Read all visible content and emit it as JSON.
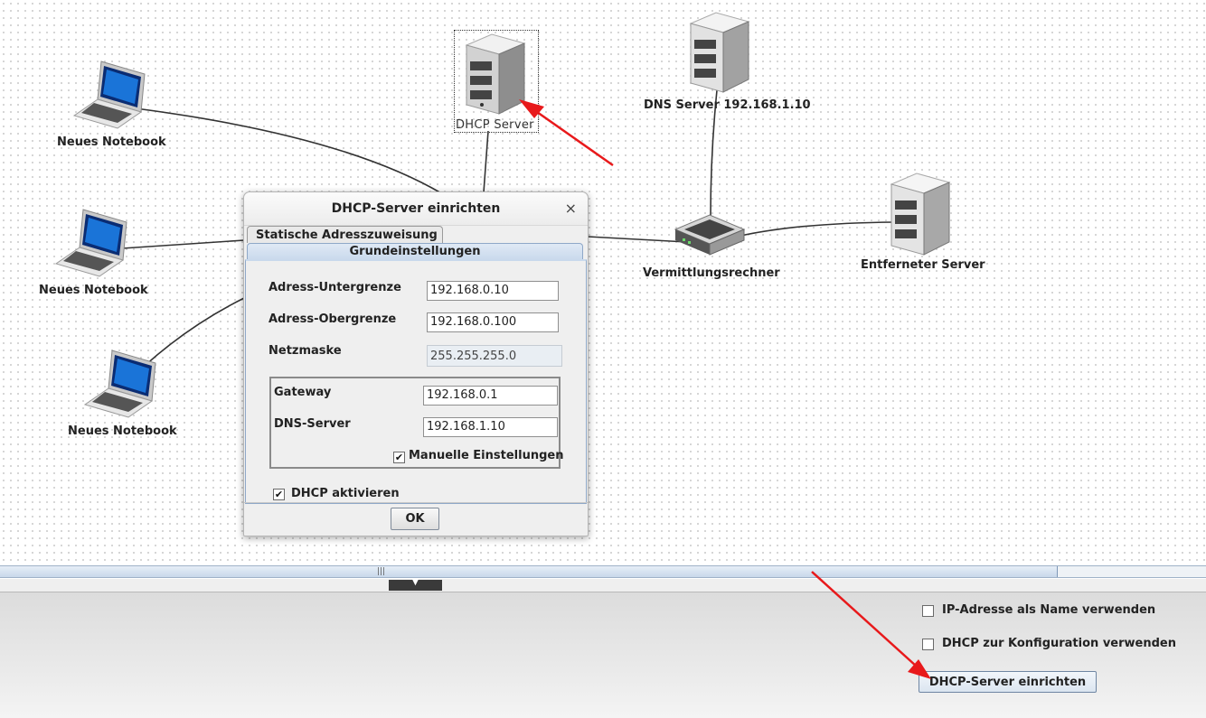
{
  "network": {
    "nodes": {
      "notebook_1": "Neues Notebook",
      "notebook_2": "Neues Notebook",
      "notebook_3": "Neues Notebook",
      "dhcp_server": "DHCP Server",
      "dns_server": "DNS Server 192.168.1.10",
      "switch": "Vermittlungsrechner",
      "remote_server": "Entferneter Server"
    },
    "icons": {
      "notebook": "laptop-icon",
      "server": "server-icon",
      "switch": "switch-icon"
    }
  },
  "dialog": {
    "title": "DHCP-Server einrichten",
    "close": "×",
    "tabs": [
      "Statische Adresszuweisung",
      "Grundeinstellungen"
    ],
    "active_tab": "Grundeinstellungen",
    "fields": {
      "lower_label": "Adress-Untergrenze",
      "lower_value": "192.168.0.10",
      "upper_label": "Adress-Obergrenze",
      "upper_value": "192.168.0.100",
      "netmask_label": "Netzmaske",
      "netmask_value": "255.255.255.0",
      "gateway_label": "Gateway",
      "gateway_value": "192.168.0.1",
      "dns_label": "DNS-Server",
      "dns_value": "192.168.1.10"
    },
    "manual_settings": {
      "label": "Manuelle Einstellungen",
      "checked": true,
      "mark": "✔"
    },
    "dhcp_enable": {
      "label": "DHCP aktivieren",
      "checked": true,
      "mark": "✔"
    },
    "ok_label": "OK"
  },
  "bottom": {
    "ip_as_name": {
      "label": "IP-Adresse als Name verwenden",
      "checked": false
    },
    "dhcp_config": {
      "label": "DHCP zur Konfiguration verwenden",
      "checked": false
    },
    "setup_button": "DHCP-Server einrichten",
    "collapse_glyph": "▼",
    "scroll_grip": "|||"
  },
  "colors": {
    "annotation_arrow": "#e8191b",
    "link": "#333333",
    "tab_active": "#c9d9ec"
  }
}
